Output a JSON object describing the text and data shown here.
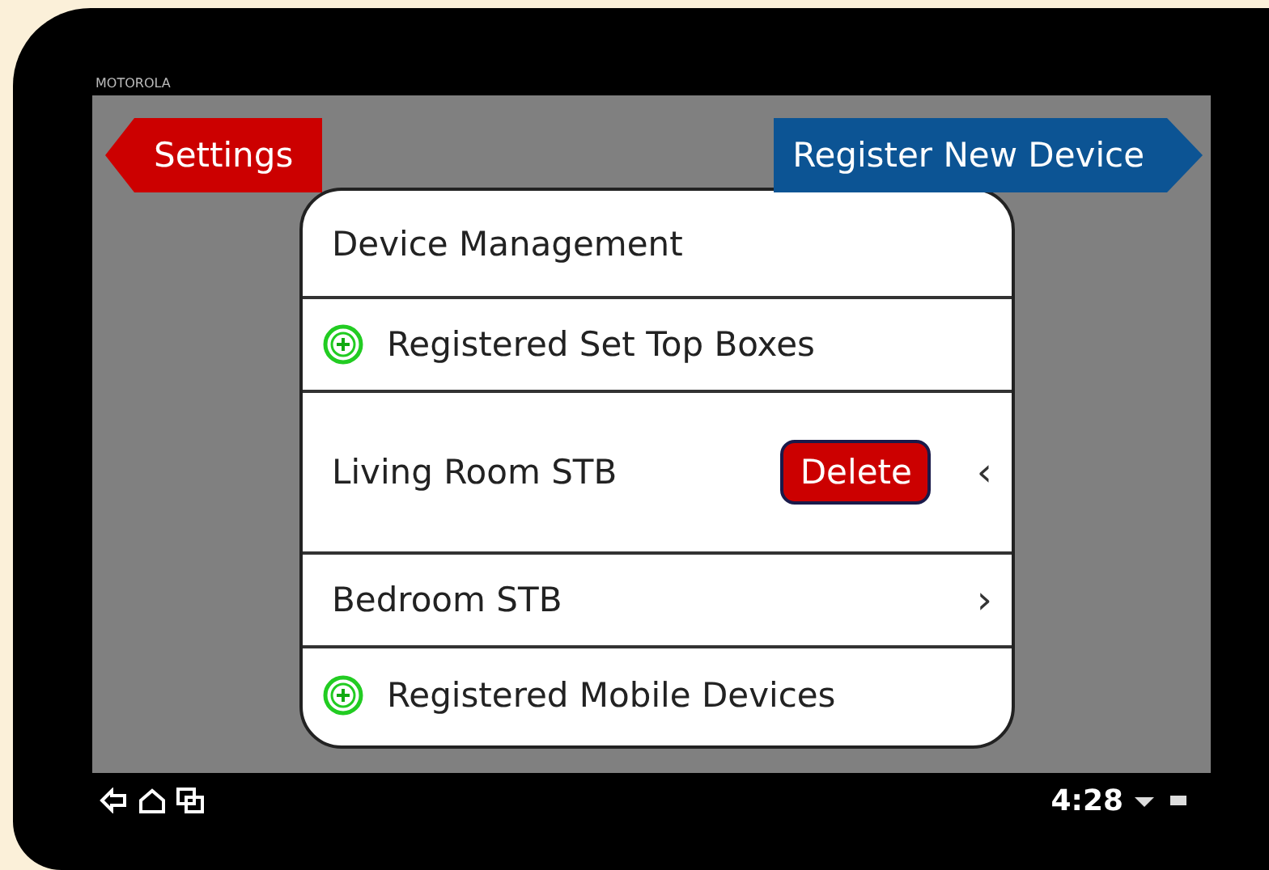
{
  "device": {
    "brand": "MOTOROLA"
  },
  "nav": {
    "back_button": "Settings",
    "action_button": "Register New Device"
  },
  "list": [
    {
      "kind": "header",
      "label": "Device Management"
    },
    {
      "kind": "section",
      "label": "Registered Set Top Boxes"
    },
    {
      "kind": "device",
      "label": "Living Room STB",
      "delete_label": "Delete",
      "chevron": "‹"
    },
    {
      "kind": "device",
      "label": "Bedroom STB",
      "chevron": "›"
    },
    {
      "kind": "section",
      "label": "Registered Mobile Devices"
    }
  ],
  "status_bar": {
    "time": "4:28"
  }
}
